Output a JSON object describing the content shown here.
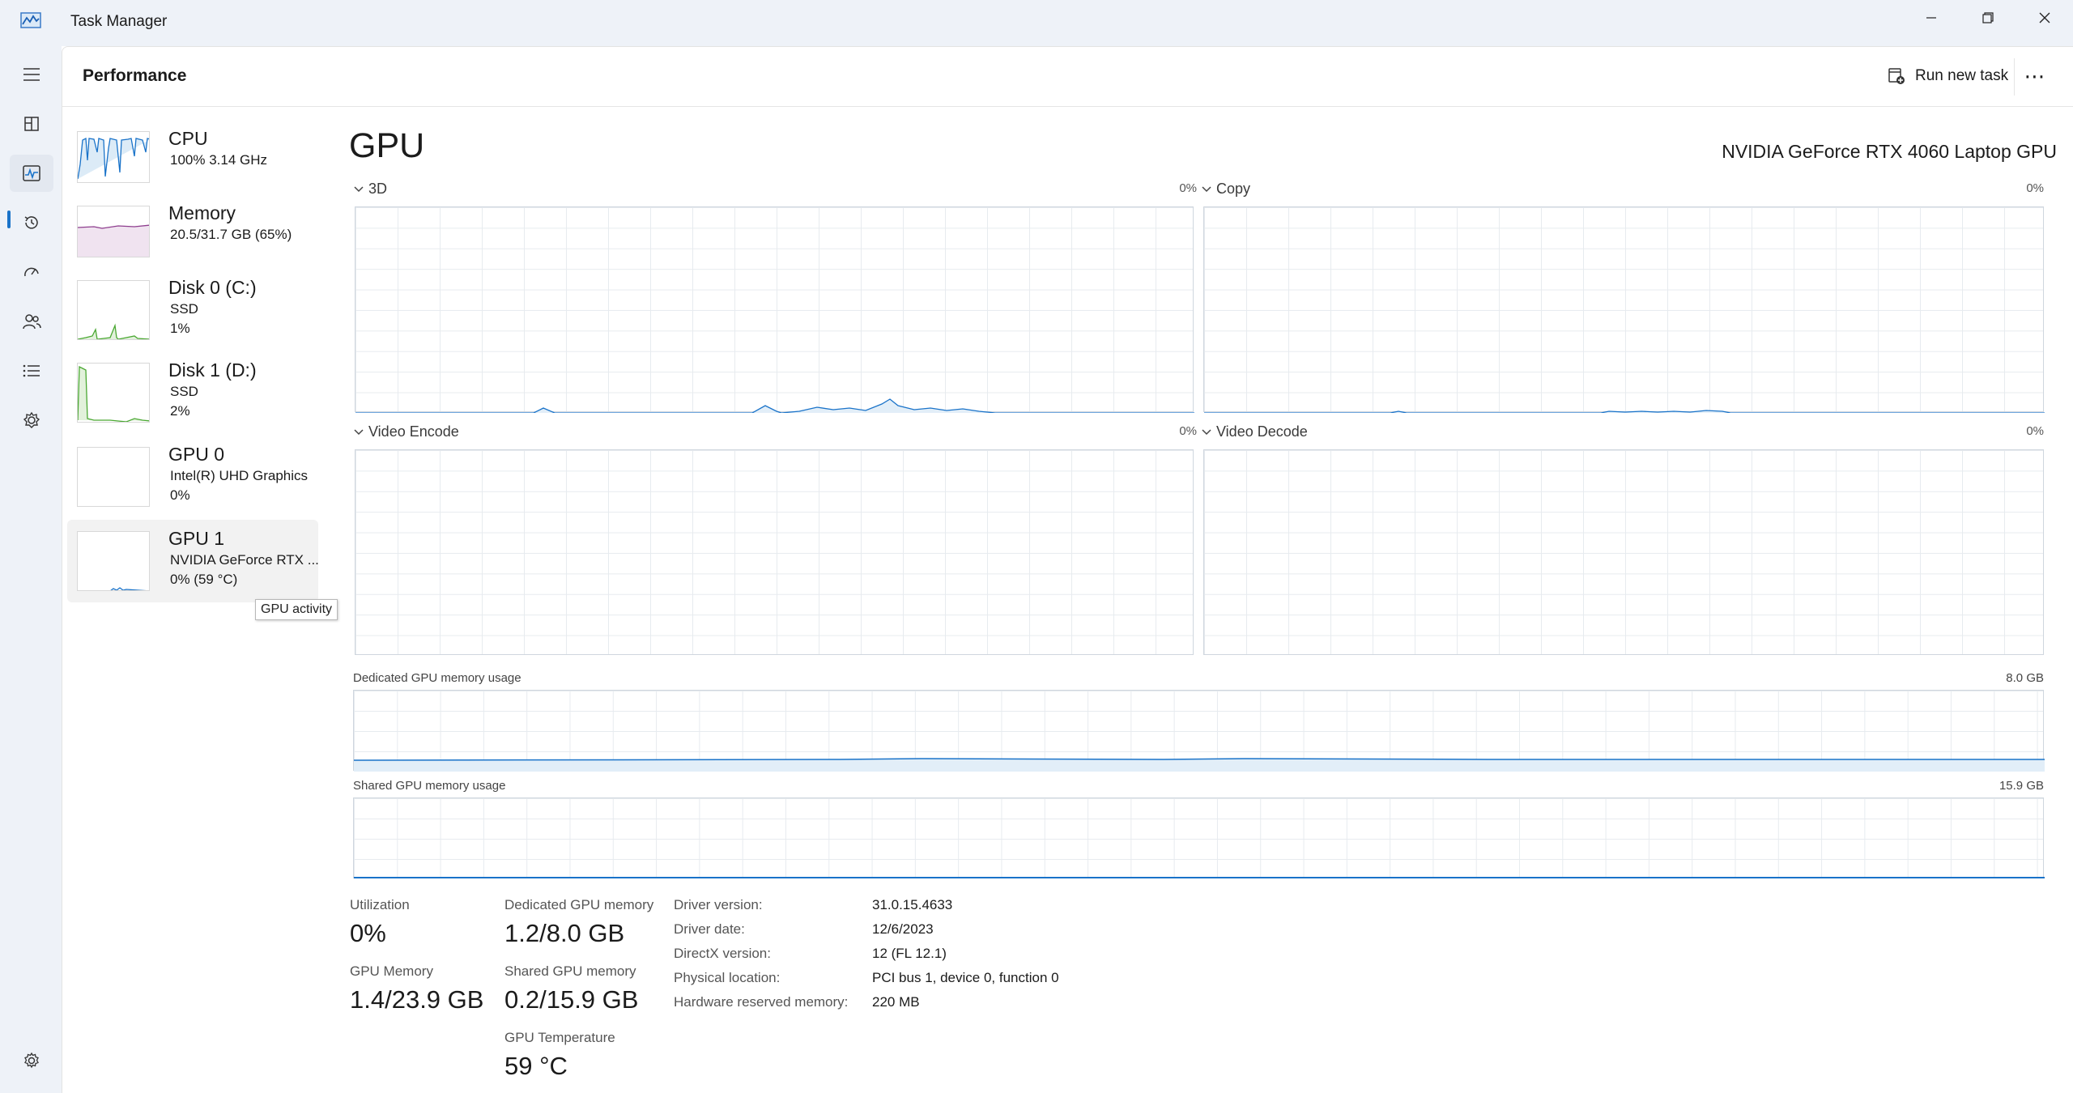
{
  "window": {
    "title": "Task Manager"
  },
  "header": {
    "title": "Performance",
    "run_new_task": "Run new task",
    "more": "⋯"
  },
  "devices": [
    {
      "name": "CPU",
      "line1": "100%  3.14 GHz",
      "line2": "",
      "color": "#1a73c9"
    },
    {
      "name": "Memory",
      "line1": "20.5/31.7 GB (65%)",
      "line2": "",
      "color": "#8e3e8e"
    },
    {
      "name": "Disk 0 (C:)",
      "line1": "SSD",
      "line2": "1%",
      "color": "#4aa832"
    },
    {
      "name": "Disk 1 (D:)",
      "line1": "SSD",
      "line2": "2%",
      "color": "#4aa832"
    },
    {
      "name": "GPU 0",
      "line1": "Intel(R) UHD Graphics",
      "line2": "0%",
      "color": "#1a73c9"
    },
    {
      "name": "GPU 1",
      "line1": "NVIDIA GeForce RTX ...",
      "line2": "0%  (59 °C)",
      "color": "#1a73c9"
    }
  ],
  "tooltip": "GPU activity",
  "gpu": {
    "title": "GPU",
    "model": "NVIDIA GeForce RTX 4060 Laptop GPU",
    "engines": [
      {
        "label": "3D",
        "max": "0%"
      },
      {
        "label": "Copy",
        "max": "0%"
      },
      {
        "label": "Video Encode",
        "max": "0%"
      },
      {
        "label": "Video Decode",
        "max": "0%"
      }
    ],
    "dedicated_label": "Dedicated GPU memory usage",
    "dedicated_max": "8.0 GB",
    "shared_label": "Shared GPU memory usage",
    "shared_max": "15.9 GB"
  },
  "stats": {
    "utilization_label": "Utilization",
    "utilization_value": "0%",
    "dedicated_label": "Dedicated GPU memory",
    "dedicated_value": "1.2/8.0 GB",
    "gpu_memory_label": "GPU Memory",
    "gpu_memory_value": "1.4/23.9 GB",
    "shared_label": "Shared GPU memory",
    "shared_value": "0.2/15.9 GB",
    "temp_label": "GPU Temperature",
    "temp_value": "59 °C"
  },
  "details": [
    {
      "key": "Driver version:",
      "value": "31.0.15.4633"
    },
    {
      "key": "Driver date:",
      "value": "12/6/2023"
    },
    {
      "key": "DirectX version:",
      "value": "12 (FL 12.1)"
    },
    {
      "key": "Physical location:",
      "value": "PCI bus 1, device 0, function 0"
    },
    {
      "key": "Hardware reserved memory:",
      "value": "220 MB"
    }
  ],
  "accent_color": "#1a73c9"
}
